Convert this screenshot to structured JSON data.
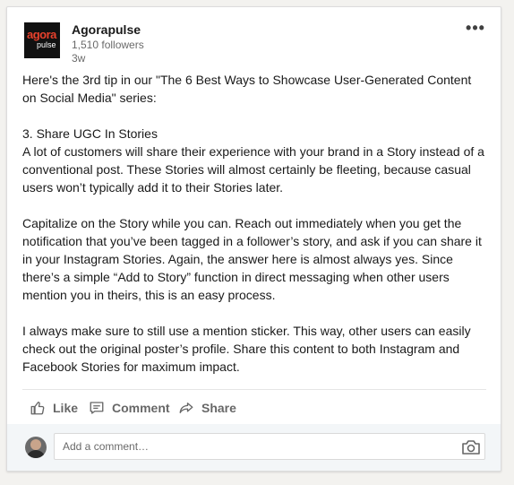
{
  "post": {
    "author": {
      "name": "Agorapulse",
      "followers": "1,510 followers",
      "time": "3w",
      "logo_line1": "agora",
      "logo_line2": "pulse"
    },
    "paragraphs": [
      "Here's the 3rd tip in our \"The 6 Best Ways to Showcase User-Generated Content on Social Media\" series:",
      "3. Share UGC In Stories\nA lot of customers will share their experience with your brand in a Story instead of a conventional post. These Stories will almost certainly be fleeting, because casual users won’t typically add it to their Stories later.",
      "Capitalize on the Story while you can. Reach out immediately when you get the notification that you’ve been tagged in a follower’s story, and ask if you can share it in your Instagram Stories. Again, the answer here is almost always yes. Since there’s a simple “Add to Story” function in direct messaging when other users mention you in theirs, this is an easy process.",
      "I always make sure to still use a mention sticker. This way, other users can easily check out the original poster’s profile. Share this content to both Instagram and Facebook Stories for maximum impact."
    ]
  },
  "actions": {
    "like": "Like",
    "comment": "Comment",
    "share": "Share"
  },
  "comment_box": {
    "placeholder": "Add a comment…"
  },
  "icons": {
    "menu": "more-options-icon",
    "like": "thumbs-up-icon",
    "comment": "comment-icon",
    "share": "share-arrow-icon",
    "camera": "camera-icon"
  }
}
